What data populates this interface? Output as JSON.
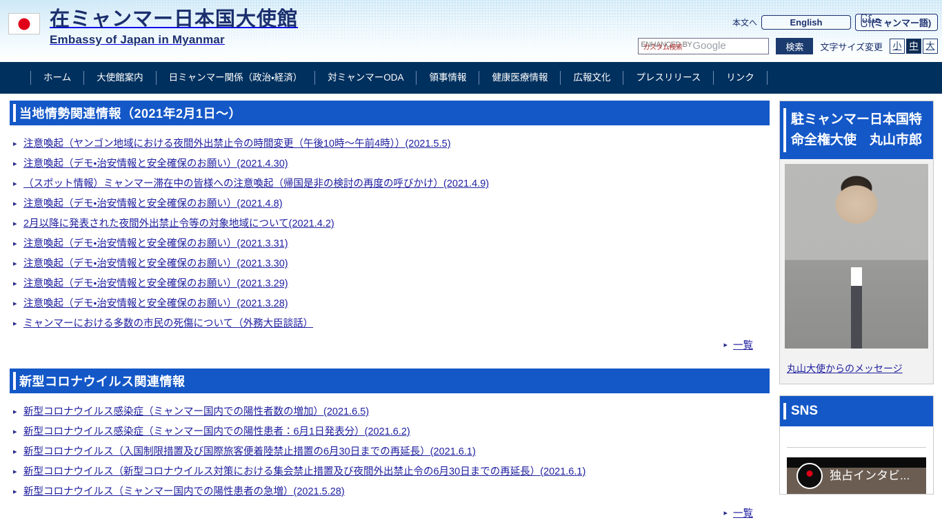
{
  "header": {
    "flag_icon": "japan-flag-icon",
    "title_jp": "在ミャンマー日本国大使館",
    "title_en": "Embassy of Japan in Myanmar",
    "skip_link": "本文へ",
    "lang_english": "English",
    "lang_myanmar_burmese": "မြန်မာ",
    "lang_myanmar_jp": "(ミャンマー語)",
    "search_placeholder_jp": "カスタム検索",
    "search_placeholder_en": "ENHANCED BY",
    "search_brand": "Google",
    "search_button": "検索",
    "fontsize_label": "文字サイズ変更",
    "fontsize_small": "小",
    "fontsize_medium": "中",
    "fontsize_large": "大",
    "fontsize_selected": "中"
  },
  "nav": {
    "items": [
      {
        "label": "ホーム"
      },
      {
        "label": "大使館案内"
      },
      {
        "label": "日ミャンマー関係（政治・経済）"
      },
      {
        "label": "対ミャンマーODA"
      },
      {
        "label": "領事情報"
      },
      {
        "label": "健康医療情報"
      },
      {
        "label": "広報文化"
      },
      {
        "label": "プレスリリース"
      },
      {
        "label": "リンク"
      }
    ]
  },
  "main": {
    "sections": [
      {
        "title": "当地情勢関連情報（2021年2月1日～）",
        "more_label": "一覧",
        "links": [
          "注意喚起（ヤンゴン地域における夜間外出禁止令の時間変更（午後10時～午前4時））(2021.5.5)",
          "注意喚起（デモ・治安情報と安全確保のお願い）(2021.4.30)",
          "（スポット情報）ミャンマー滞在中の皆様への注意喚起（帰国是非の検討の再度の呼びかけ）(2021.4.9)",
          "注意喚起（デモ・治安情報と安全確保のお願い）(2021.4.8)",
          "2月以降に発表された夜間外出禁止令等の対象地域について(2021.4.2)",
          "注意喚起（デモ・治安情報と安全確保のお願い）(2021.3.31)",
          "注意喚起（デモ・治安情報と安全確保のお願い）(2021.3.30)",
          "注意喚起（デモ・治安情報と安全確保のお願い）(2021.3.29)",
          "注意喚起（デモ・治安情報と安全確保のお願い）(2021.3.28)",
          "ミャンマーにおける多数の市民の死傷について（外務大臣談話）"
        ]
      },
      {
        "title": "新型コロナウイルス関連情報",
        "more_label": "一覧",
        "links": [
          "新型コロナウイルス感染症（ミャンマー国内での陽性者数の増加）(2021.6.5)",
          "新型コロナウイルス感染症（ミャンマー国内での陽性患者：6月1日発表分）(2021.6.2)",
          "新型コロナウイルス（入国制限措置及び国際旅客便着陸禁止措置の6月30日までの再延長）(2021.6.1)",
          "新型コロナウイルス（新型コロナウイルス対策における集会禁止措置及び夜間外出禁止令の6月30日までの再延長）(2021.6.1)",
          "新型コロナウイルス（ミャンマー国内での陽性患者の急増）(2021.5.28)"
        ]
      }
    ]
  },
  "sidebar": {
    "ambassador": {
      "heading": "駐ミャンマー日本国特命全権大使　丸山市郎",
      "photo_alt": "ambassador-portrait",
      "message_link": "丸山大使からのメッセージ"
    },
    "sns": {
      "heading": "SNS",
      "thumb_caption": "独占インタビ...",
      "logo_icon": "embassy-seal-icon"
    }
  },
  "colors": {
    "nav_bg": "#00305e",
    "section_header_bg": "#1458c8",
    "link": "#2020a0",
    "brand_text": "#1b2f6e",
    "flag_red": "#e00017"
  }
}
